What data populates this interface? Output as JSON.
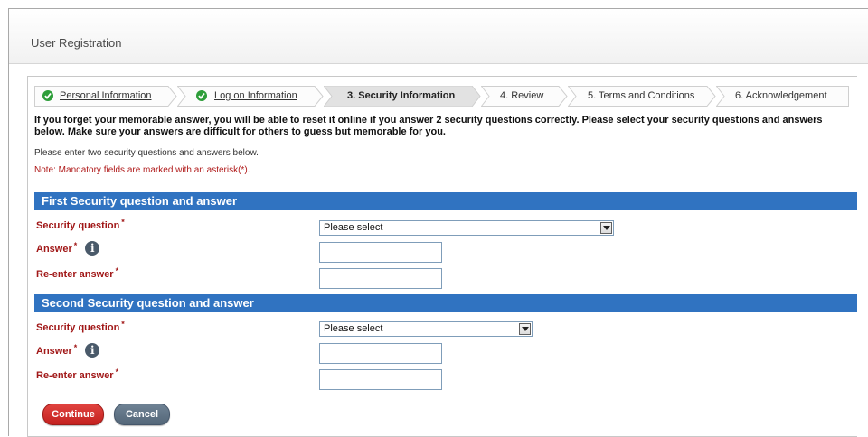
{
  "window": {
    "title": "User Registration"
  },
  "steps": [
    {
      "label": "Personal Information",
      "status": "completed"
    },
    {
      "label": "Log on Information",
      "status": "completed"
    },
    {
      "label": "3. Security Information",
      "status": "current"
    },
    {
      "label": "4. Review",
      "status": "pending"
    },
    {
      "label": "5. Terms and Conditions",
      "status": "pending"
    },
    {
      "label": "6. Acknowledgement",
      "status": "pending"
    }
  ],
  "intro": {
    "text": "If you forget your memorable answer, you will be able to reset it online if you answer 2 security questions correctly. Please select your security questions and answers below. Make sure your answers are difficult for others to guess but memorable for you.",
    "instruction": "Please enter two security questions and answers below.",
    "mandatory_note": "Note: Mandatory fields are marked with an asterisk(*)."
  },
  "sections": [
    {
      "title": "First Security question and answer",
      "question_label": "Security question",
      "question_value": "Please select",
      "answer_label": "Answer",
      "reenter_label": "Re-enter answer"
    },
    {
      "title": "Second Security question and answer",
      "question_label": "Security question",
      "question_value": "Please select",
      "answer_label": "Answer",
      "reenter_label": "Re-enter answer"
    }
  ],
  "asterisk": "*",
  "info_icon_glyph": "i",
  "buttons": {
    "continue": "Continue",
    "cancel": "Cancel"
  },
  "colors": {
    "section_header": "#3073c1",
    "required_label": "#a11818",
    "continue_button": "#c4211f",
    "cancel_button": "#546779",
    "completed_check": "#2e9e3a"
  },
  "icons": {
    "completed": "check-circle-icon",
    "help": "info-icon",
    "dropdown": "chevron-down-icon"
  }
}
